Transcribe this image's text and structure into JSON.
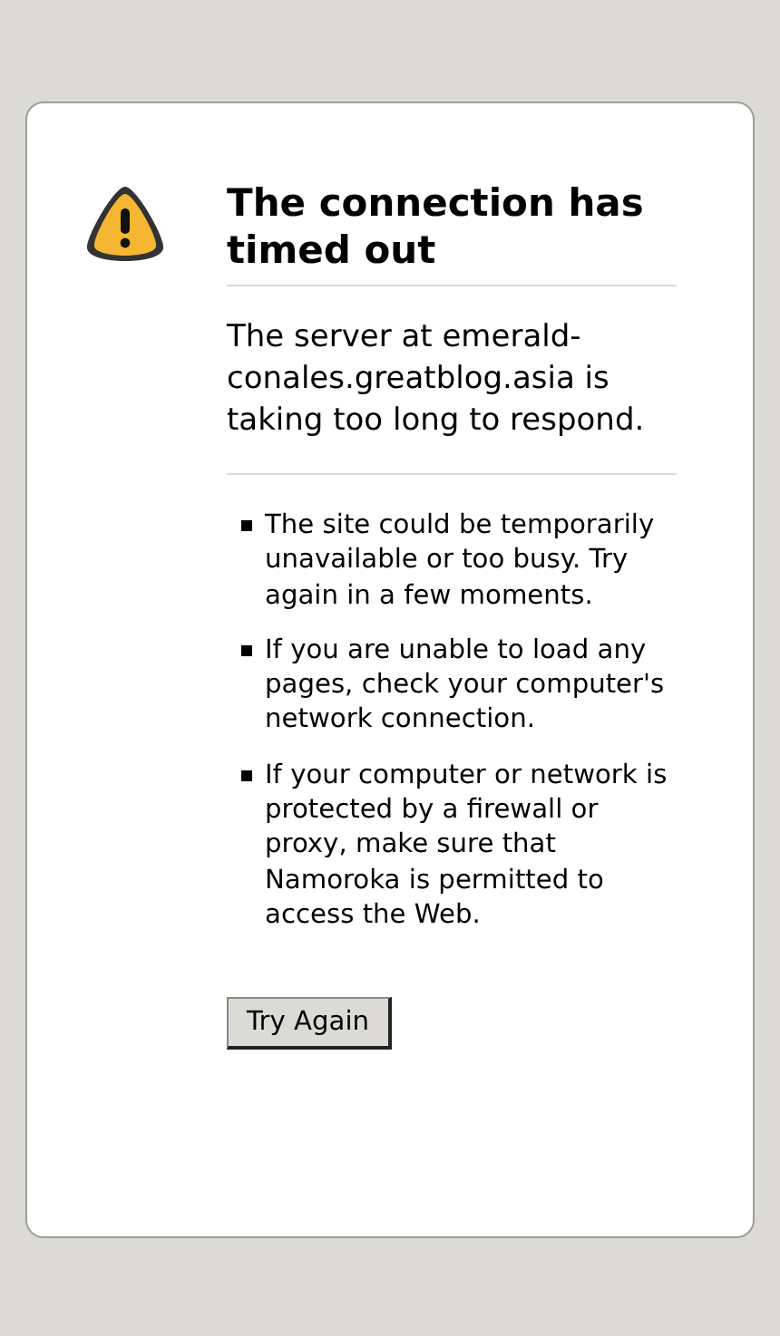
{
  "title": "The connection has timed out",
  "message": "The server at emerald-conales.greatblog.asia is taking too long to respond.",
  "suggestions": [
    "The site could be temporarily unavailable or too busy. Try again in a few moments.",
    "If you are unable to load any pages, check your computer's network connection.",
    "If your computer or network is protected by a firewall or proxy, make sure that Namoroka is permitted to access the Web."
  ],
  "button": "Try Again"
}
